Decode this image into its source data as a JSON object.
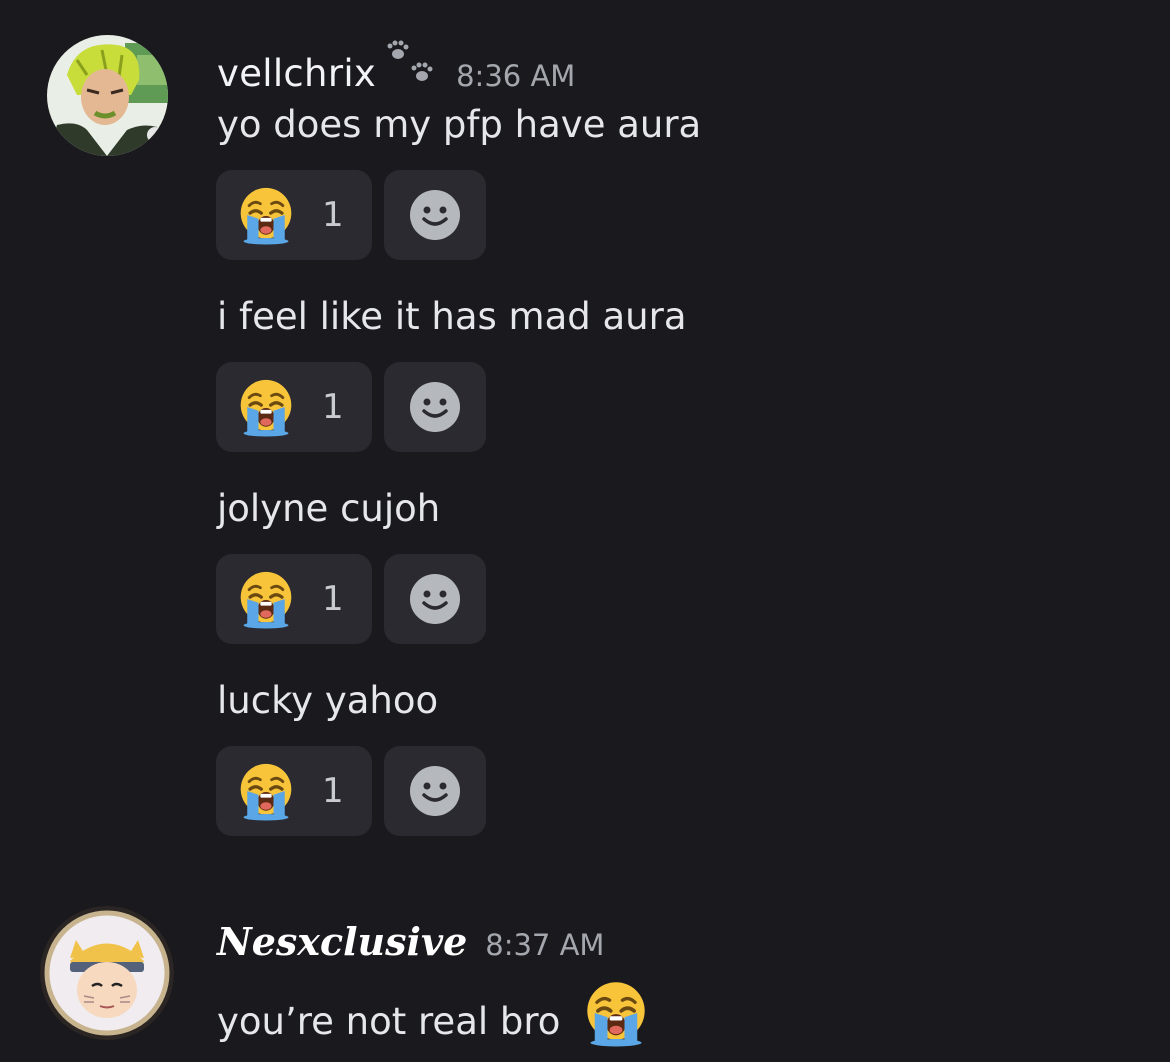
{
  "messages": [
    {
      "author": "vellchrix",
      "author_badge_icon": "paw-prints-icon",
      "timestamp": "8:36 AM",
      "lines": [
        {
          "text": "yo does my pfp have aura",
          "reaction": {
            "emoji": "loudly-crying-face",
            "count": "1"
          }
        },
        {
          "text": "i feel like it has mad aura",
          "reaction": {
            "emoji": "loudly-crying-face",
            "count": "1"
          }
        },
        {
          "text": "jolyne cujoh",
          "reaction": {
            "emoji": "loudly-crying-face",
            "count": "1"
          }
        },
        {
          "text": "lucky yahoo",
          "reaction": {
            "emoji": "loudly-crying-face",
            "count": "1"
          }
        }
      ]
    },
    {
      "author": "Nesxclusive",
      "timestamp": "8:37 AM",
      "lines": [
        {
          "text": "you’re not real bro",
          "trailing_emoji": "loudly-crying-face"
        }
      ]
    }
  ],
  "colors": {
    "background": "#1a1a1e",
    "reaction_bg": "#2a2a30",
    "timestamp": "#a5a7ae",
    "message_text": "#e6e7ea"
  }
}
